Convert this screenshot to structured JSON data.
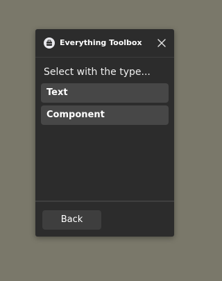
{
  "window": {
    "title": "Everything Toolbox",
    "app_icon": "toolbox-icon",
    "close_icon": "close-icon"
  },
  "main": {
    "prompt": "Select with the type...",
    "options": [
      {
        "label": "Text"
      },
      {
        "label": "Component"
      }
    ]
  },
  "footer": {
    "back_label": "Back"
  },
  "colors": {
    "desktop_background": "#7a786a",
    "panel_background": "#2c2c2c",
    "option_background": "#474747",
    "button_background": "#3e3e3e",
    "text": "#ffffff"
  }
}
